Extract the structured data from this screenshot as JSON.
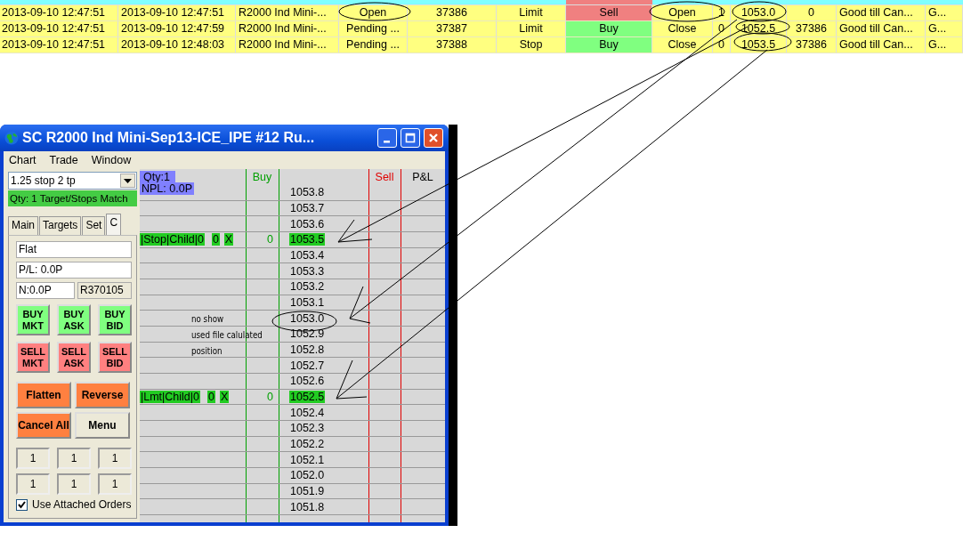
{
  "orders_table": {
    "rows": [
      {
        "kind": "sell",
        "cells": [
          "2013-09-10  12:47:51",
          "2013-09-10  12:47:51",
          "R2000 Ind Mini-...",
          "Open",
          "37386",
          "Limit",
          "Sell",
          "Open",
          "1",
          "1053.0",
          "0",
          "Good till Can...",
          "G..."
        ]
      },
      {
        "kind": "buy",
        "cells": [
          "2013-09-10  12:47:51",
          "2013-09-10  12:47:59",
          "R2000 Ind Mini-...",
          "Pending ...",
          "37387",
          "Limit",
          "Buy",
          "Close",
          "0",
          "1052.5",
          "37386",
          "Good till Can...",
          "G..."
        ]
      },
      {
        "kind": "buy",
        "cells": [
          "2013-09-10  12:47:51",
          "2013-09-10  12:48:03",
          "R2000 Ind Mini-...",
          "Pending ...",
          "37388",
          "Stop",
          "Buy",
          "Close",
          "0",
          "1053.5",
          "37386",
          "Good till Can...",
          "G..."
        ]
      }
    ]
  },
  "window": {
    "title": "SC R2000 Ind Mini-Sep13-ICE_IPE  #12  Ru...",
    "menu": [
      "Chart",
      "Trade",
      "Window"
    ],
    "preset": "1.25 stop 2 tp",
    "status": "Qty: 1 Target/Stops Match",
    "tabs": [
      {
        "label": "Main",
        "selected": false
      },
      {
        "label": "Targets",
        "selected": false
      },
      {
        "label": "Set",
        "selected": false
      },
      {
        "label": "C",
        "selected": true
      }
    ],
    "position": "Flat",
    "pl": "P/L: 0.0P",
    "net": "N:0.0P",
    "account": "R370105",
    "buttons": [
      {
        "kind": "buy",
        "lines": [
          "BUY",
          "MKT"
        ]
      },
      {
        "kind": "buy",
        "lines": [
          "BUY",
          "ASK"
        ]
      },
      {
        "kind": "buy",
        "lines": [
          "BUY",
          "BID"
        ]
      },
      {
        "kind": "sell",
        "lines": [
          "SELL",
          "MKT"
        ]
      },
      {
        "kind": "sell",
        "lines": [
          "SELL",
          "ASK"
        ]
      },
      {
        "kind": "sell",
        "lines": [
          "SELL",
          "BID"
        ]
      }
    ],
    "actions": [
      {
        "kind": "orange",
        "label": "Flatten"
      },
      {
        "kind": "orange",
        "label": "Reverse"
      },
      {
        "kind": "orange",
        "label": "Cancel All"
      },
      {
        "kind": "plain",
        "label": "Menu"
      }
    ],
    "quantities": [
      "1",
      "1",
      "1",
      "1",
      "1",
      "1"
    ],
    "attached": {
      "label": "Use Attached Orders",
      "checked": true
    },
    "ladder": {
      "qty": "Qty:1",
      "npl": "NPL: 0.0P",
      "buy": "Buy",
      "sell": "Sell",
      "pl": "P&L",
      "note_lines": [
        "no show",
        "used file calulated",
        "position"
      ],
      "rows": [
        {
          "price": "1053.8",
          "highlighted": false
        },
        {
          "price": "1053.7",
          "highlighted": false
        },
        {
          "price": "1053.6",
          "highlighted": false
        },
        {
          "price": "1053.5",
          "highlighted": true,
          "order": {
            "label": "|Stop|Child|0",
            "qty": "0",
            "cancel": "X"
          },
          "buy_qty": "0"
        },
        {
          "price": "1053.4",
          "highlighted": false
        },
        {
          "price": "1053.3",
          "highlighted": false
        },
        {
          "price": "1053.2",
          "highlighted": false
        },
        {
          "price": "1053.1",
          "highlighted": false
        },
        {
          "price": "1053.0",
          "highlighted": false
        },
        {
          "price": "1052.9",
          "highlighted": false
        },
        {
          "price": "1052.8",
          "highlighted": false
        },
        {
          "price": "1052.7",
          "highlighted": false
        },
        {
          "price": "1052.6",
          "highlighted": false
        },
        {
          "price": "1052.5",
          "highlighted": true,
          "order": {
            "label": "|Lmt|Child|0",
            "qty": "0",
            "cancel": "X"
          },
          "buy_qty": "0"
        },
        {
          "price": "1052.4",
          "highlighted": false
        },
        {
          "price": "1052.3",
          "highlighted": false
        },
        {
          "price": "1052.2",
          "highlighted": false
        },
        {
          "price": "1052.1",
          "highlighted": false
        },
        {
          "price": "1052.0",
          "highlighted": false
        },
        {
          "price": "1051.9",
          "highlighted": false
        },
        {
          "price": "1051.8",
          "highlighted": false
        }
      ]
    }
  }
}
